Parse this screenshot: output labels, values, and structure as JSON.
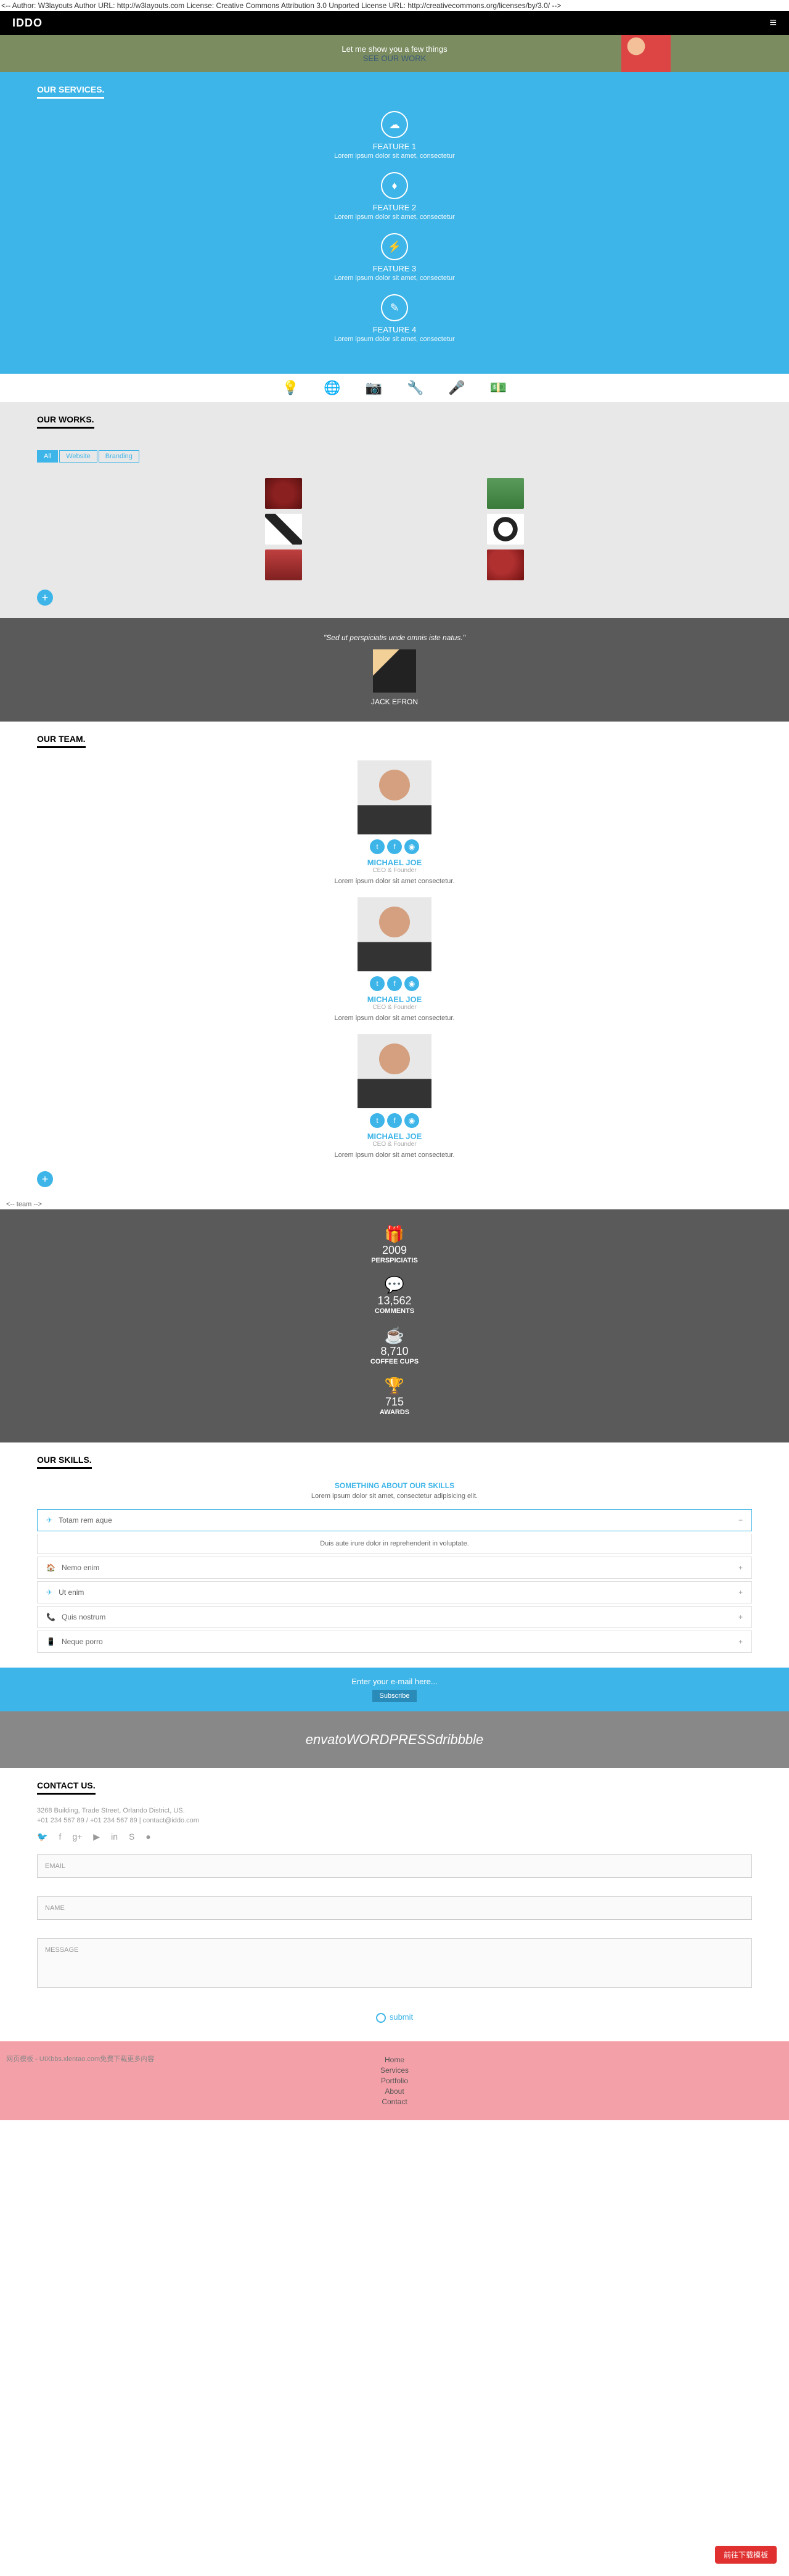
{
  "topComment": "<-- Author: W3layouts Author URL: http://w3layouts.com License: Creative Commons Attribution 3.0 Unported License URL: http://creativecommons.org/licenses/by/3.0/ -->",
  "logo": "IDDO",
  "banner": {
    "text": "Let me show you a few things",
    "link": "SEE OUR WORK"
  },
  "services": {
    "title": "OUR SERVICES.",
    "features": [
      {
        "icon": "☁",
        "title": "FEATURE 1",
        "desc": "Lorem ipsum dolor sit amet, consectetur"
      },
      {
        "icon": "♦",
        "title": "FEATURE 2",
        "desc": "Lorem ipsum dolor sit amet, consectetur"
      },
      {
        "icon": "⚡",
        "title": "FEATURE 3",
        "desc": "Lorem ipsum dolor sit amet, consectetur"
      },
      {
        "icon": "✎",
        "title": "FEATURE 4",
        "desc": "Lorem ipsum dolor sit amet, consectetur"
      }
    ]
  },
  "iconBar": [
    "💡",
    "🌐",
    "📷",
    "🔧",
    "🎤",
    "💵"
  ],
  "works": {
    "title": "OUR WORKS.",
    "tabs": [
      "All",
      "Website",
      "Branding"
    ]
  },
  "testimonial": {
    "text": "\"Sed ut perspiciatis unde omnis iste natus.\"",
    "name": "JACK EFRON"
  },
  "team": {
    "title": "OUR TEAM.",
    "members": [
      {
        "name": "MICHAEL JOE",
        "role": "CEO & Founder",
        "desc": "Lorem ipsum dolor sit amet consectetur."
      },
      {
        "name": "MICHAEL JOE",
        "role": "CEO & Founder",
        "desc": "Lorem ipsum dolor sit amet consectetur."
      },
      {
        "name": "MICHAEL JOE",
        "role": "CEO & Founder",
        "desc": "Lorem ipsum dolor sit amet consectetur."
      }
    ],
    "comment": "<-- team -->"
  },
  "stats": [
    {
      "icon": "🎁",
      "num": "2009",
      "label": "PERSPICIATIS"
    },
    {
      "icon": "💬",
      "num": "13,562",
      "label": "COMMENTS"
    },
    {
      "icon": "☕",
      "num": "8,710",
      "label": "COFFEE CUPS"
    },
    {
      "icon": "🏆",
      "num": "715",
      "label": "AWARDS"
    }
  ],
  "skills": {
    "title": "OUR SKILLS.",
    "subtitle": "SOMETHING ABOUT OUR SKILLS",
    "desc": "Lorem ipsum dolor sit amet, consectetur adipisicing elit.",
    "items": [
      {
        "icon": "✈",
        "label": "Totam rem aque",
        "open": true,
        "content": "Duis aute irure dolor in reprehenderit in voluptate."
      },
      {
        "icon": "🏠",
        "label": "Nemo enim"
      },
      {
        "icon": "✈",
        "label": "Ut enim"
      },
      {
        "icon": "📞",
        "label": "Quis nostrum"
      },
      {
        "icon": "📱",
        "label": "Neque porro"
      }
    ]
  },
  "subscribe": {
    "text": "Enter your e-mail here...",
    "btn": "Subscribe"
  },
  "brands": [
    "envato",
    "WORDPRESS",
    "dribbble"
  ],
  "contact": {
    "title": "CONTACT US.",
    "addr": "3268 Building, Trade Street, Orlando District, US.",
    "phone": "+01 234 567 89 / +01 234 567 89 | contact@iddo.com",
    "fields": [
      "EMAIL",
      "NAME",
      "MESSAGE"
    ],
    "submit": "submit"
  },
  "footer": {
    "links": [
      "Home",
      "Services",
      "Portfolio",
      "About",
      "Contact"
    ],
    "credit": "网页模板 - UIXbbs.xlentao.com免费下载更多内容"
  },
  "downloadBtn": "前往下载模板"
}
